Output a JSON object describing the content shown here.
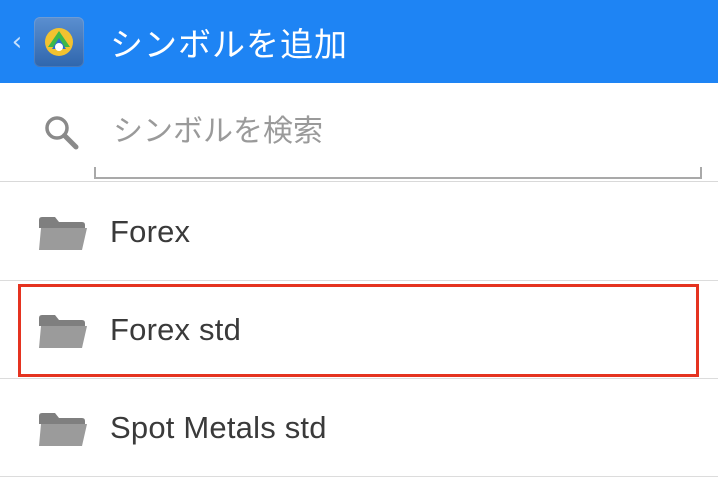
{
  "app_bar": {
    "back_icon": "chevron-left-icon",
    "app_icon": "metatrader-logo-icon",
    "title": "シンボルを追加",
    "background_color": "#1e84f4"
  },
  "search": {
    "icon": "search-icon",
    "placeholder": "シンボルを検索",
    "value": ""
  },
  "folders": [
    {
      "label": "Forex",
      "icon": "folder-icon"
    },
    {
      "label": "Forex std",
      "icon": "folder-icon",
      "highlighted": true
    },
    {
      "label": "Spot Metals std",
      "icon": "folder-icon"
    }
  ],
  "highlight_color": "#e53320"
}
